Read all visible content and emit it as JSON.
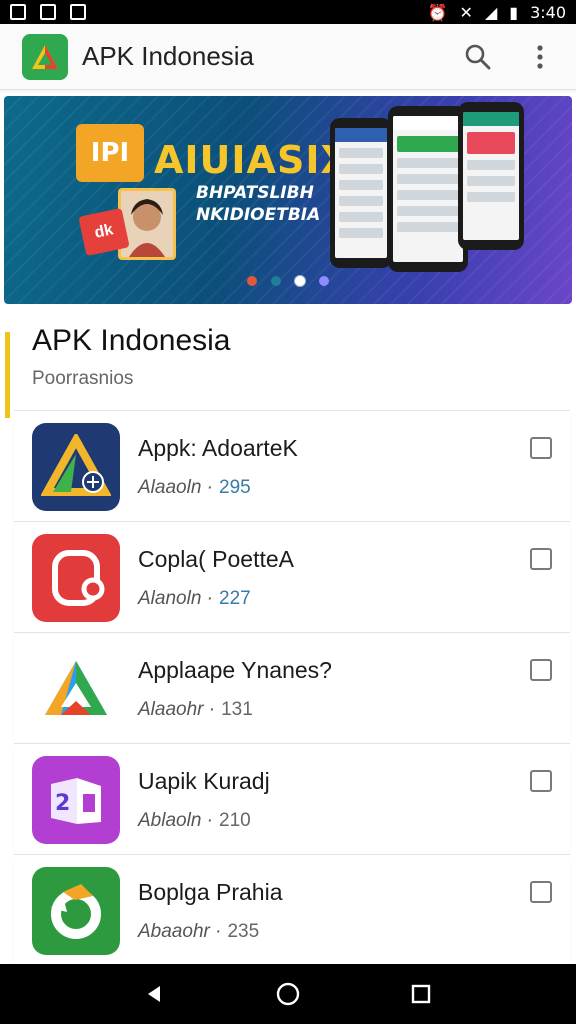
{
  "statusbar": {
    "time": "3:40"
  },
  "appbar": {
    "title": "APK Indonesia"
  },
  "banner": {
    "badge": "IPI",
    "headline": "AIUIASIX",
    "subline": "BHPATSLIBH NKIDIOETBIA",
    "tag": "dk",
    "dots": [
      "#e25a3a",
      "#1e7f96",
      "#ffffff",
      "#8a8cff"
    ],
    "active_dot": 2
  },
  "section": {
    "title": "APK Indonesia",
    "subtitle": "Poorrasnios"
  },
  "apps": [
    {
      "name": "Appk: AdoarteK",
      "author": "Alaaoln ·",
      "count": "295",
      "icon": "aurora-triangle-icon",
      "bg": "#1f3a73",
      "checked": false
    },
    {
      "name": "Copla( PoetteA",
      "author": "Alanoln ·",
      "count": "227",
      "icon": "red-loop-icon",
      "bg": "#e23b3b",
      "checked": false
    },
    {
      "name": "Applaape Ynanes?",
      "author": "Alaaohr ·",
      "count": "131",
      "icon": "color-triangle-icon",
      "bg": "#ffffff",
      "checked": false
    },
    {
      "name": "Uapik Kuradj",
      "author": "Ablaoln ·",
      "count": "210",
      "icon": "purple-box-icon",
      "bg": "#b23fd1",
      "checked": false
    },
    {
      "name": "Boplga Prahia",
      "author": "Abaaohr ·",
      "count": "235",
      "icon": "green-ring-icon",
      "bg": "#2e9a3f",
      "checked": false
    }
  ]
}
